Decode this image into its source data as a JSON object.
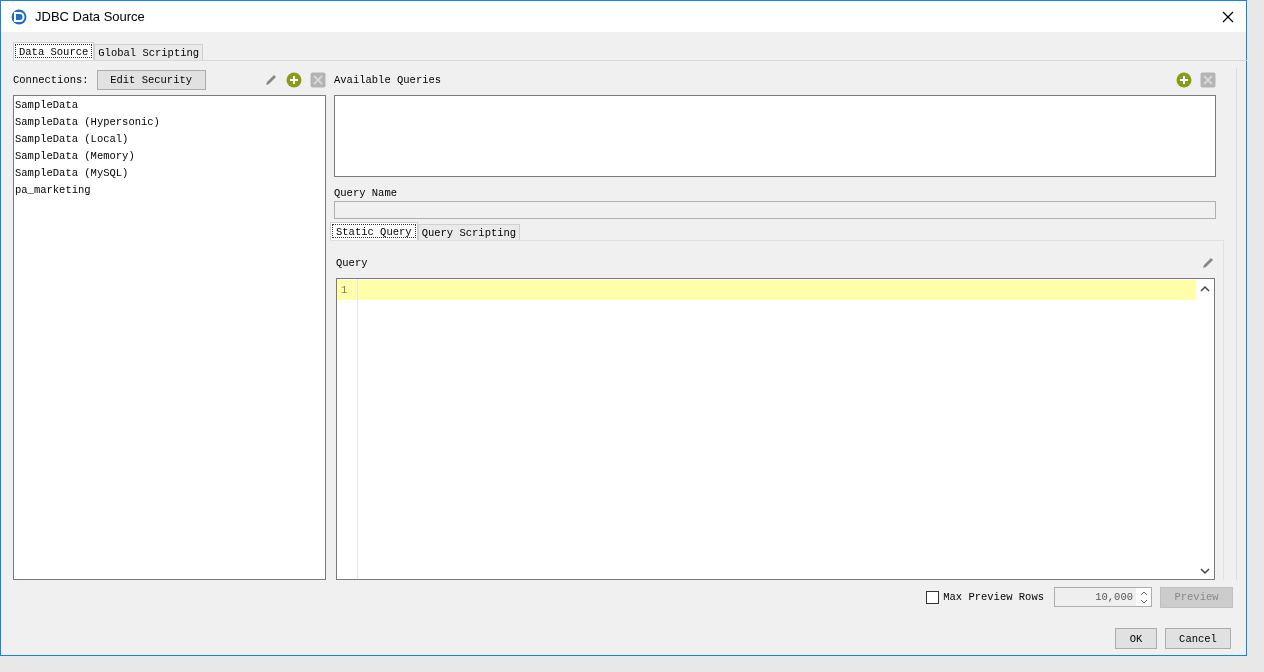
{
  "window": {
    "title": "JDBC Data Source"
  },
  "tabs": [
    {
      "label": "Data Source",
      "selected": true
    },
    {
      "label": "Global Scripting",
      "selected": false
    }
  ],
  "connections": {
    "label": "Connections:",
    "edit_button": "Edit Security",
    "items": [
      "SampleData",
      "SampleData (Hypersonic)",
      "SampleData (Local)",
      "SampleData (Memory)",
      "SampleData (MySQL)",
      "pa_marketing"
    ]
  },
  "queries": {
    "label": "Available Queries"
  },
  "query_name": {
    "label": "Query Name"
  },
  "query_tabs": [
    {
      "label": "Static Query",
      "selected": true
    },
    {
      "label": "Query Scripting",
      "selected": false
    }
  ],
  "query_editor": {
    "label": "Query",
    "line_numbers": [
      "1"
    ]
  },
  "preview": {
    "checkbox_label": "Max Preview Rows",
    "checked": false,
    "rows_value": "10,000",
    "button": "Preview",
    "button_disabled": true
  },
  "buttons": [
    "OK",
    "Cancel"
  ]
}
